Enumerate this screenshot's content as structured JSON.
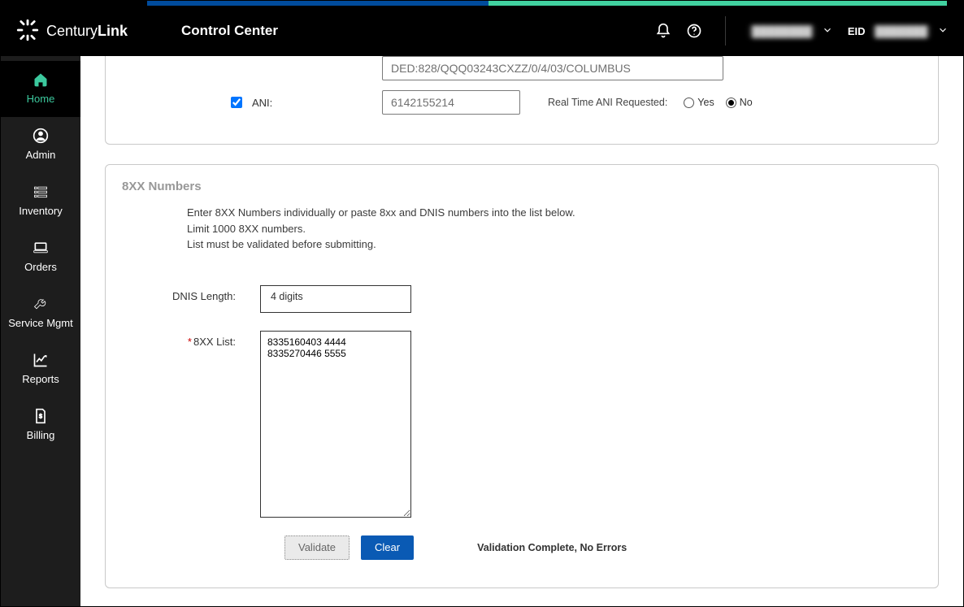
{
  "brand": {
    "part1": "Century",
    "part2": "Link"
  },
  "app_title": "Control Center",
  "eid_label": "EID",
  "user_masked": "████████",
  "eid_masked": "███████",
  "sidebar": {
    "items": [
      {
        "label": "Home"
      },
      {
        "label": "Admin"
      },
      {
        "label": "Inventory"
      },
      {
        "label": "Orders"
      },
      {
        "label": "Service Mgmt"
      },
      {
        "label": "Reports"
      },
      {
        "label": "Billing"
      }
    ]
  },
  "upper_panel": {
    "field1_value": "DED:828/QQQ03243CXZZ/0/4/03/COLUMBUS",
    "ani_label": "ANI:",
    "ani_value": "6142155214",
    "rt_label": "Real Time ANI Requested:",
    "yes": "Yes",
    "no": "No",
    "rt_selected": "No"
  },
  "lower_panel": {
    "title": "8XX Numbers",
    "instr1": "Enter 8XX Numbers individually or paste 8xx and DNIS numbers into the list below.",
    "instr2": "Limit 1000 8XX numbers.",
    "instr3": "List must be validated before submitting.",
    "dnis_label": "DNIS Length:",
    "dnis_value": "4 digits",
    "list_label": "8XX List:",
    "list_value": "8335160403 4444\n8335270446 5555",
    "validate_btn": "Validate",
    "clear_btn": "Clear",
    "validation_msg": "Validation Complete, No Errors"
  }
}
